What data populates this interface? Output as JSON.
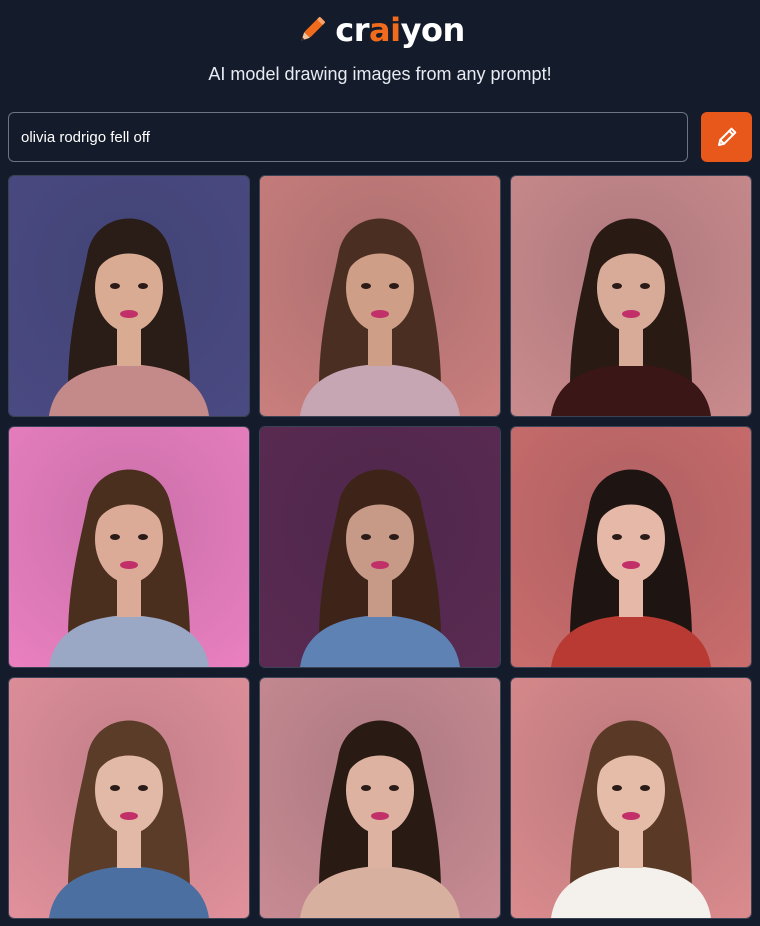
{
  "header": {
    "logo_text_prefix": "cr",
    "logo_text_accent": "ai",
    "logo_text_suffix": "yon",
    "logo_icon": "pencil-icon",
    "tagline": "AI model drawing images from any prompt!"
  },
  "prompt": {
    "value": "olivia rodrigo fell off",
    "button_icon": "pencil-icon"
  },
  "colors": {
    "background": "#141b2b",
    "accent": "#e8581a",
    "logo_accent": "#f06b1c"
  },
  "results": [
    {
      "bg": "#4a4a82",
      "hair": "#2a1c16",
      "skin": "#d9ab92",
      "top": "#c48a8a"
    },
    {
      "bg": "#c87e7c",
      "hair": "#4a2e22",
      "skin": "#cf9e86",
      "top": "#c7a6b3"
    },
    {
      "bg": "#c98a8c",
      "hair": "#2a1a14",
      "skin": "#d8aa98",
      "top": "#3a1616"
    },
    {
      "bg": "#e97fbf",
      "hair": "#4a2e1e",
      "skin": "#dcab98",
      "top": "#9aa8c6"
    },
    {
      "bg": "#5a2a52",
      "hair": "#3e2418",
      "skin": "#c79a88",
      "top": "#5f82b4"
    },
    {
      "bg": "#c96c6c",
      "hair": "#1e1412",
      "skin": "#e6b8a8",
      "top": "#b83a32"
    },
    {
      "bg": "#e0909a",
      "hair": "#5a3c28",
      "skin": "#e2b8a6",
      "top": "#4a6fa0"
    },
    {
      "bg": "#c78a92",
      "hair": "#2a1a14",
      "skin": "#ddb2a0",
      "top": "#d8b0a0"
    },
    {
      "bg": "#d98a8c",
      "hair": "#5a3a26",
      "skin": "#e4bca8",
      "top": "#f4f0ec"
    }
  ]
}
